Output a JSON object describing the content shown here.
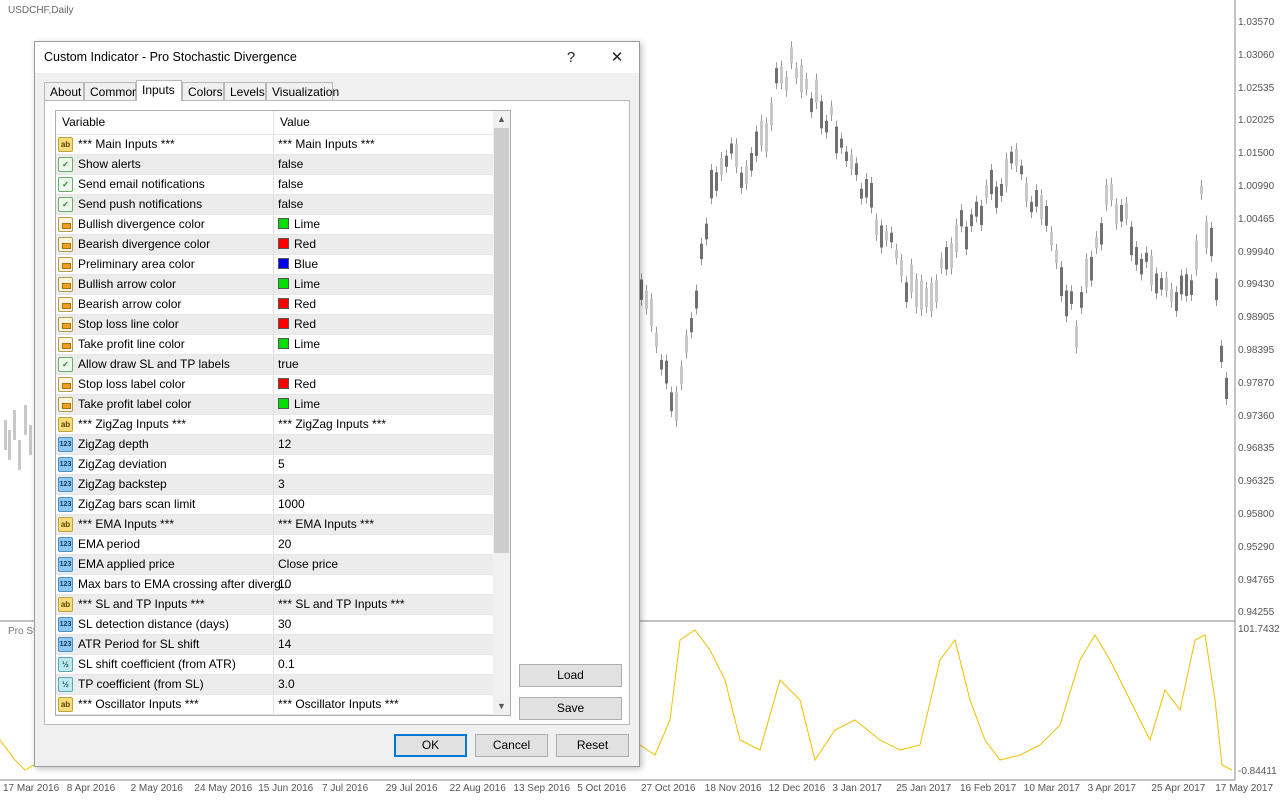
{
  "chart": {
    "symbol": "USDCHF,Daily",
    "price_axis": [
      "1.03570",
      "1.03060",
      "1.02535",
      "1.02025",
      "1.01500",
      "1.00990",
      "1.00465",
      "0.99940",
      "0.99430",
      "0.98905",
      "0.98395",
      "0.97870",
      "0.97360",
      "0.96835",
      "0.96325",
      "0.95800",
      "0.95290",
      "0.94765",
      "0.94255"
    ],
    "osc_axis_top": "101.74323",
    "osc_axis_bottom": "-0.84411",
    "osc_label": "Pro Sto",
    "date_axis": [
      "17 Mar 2016",
      "8 Apr 2016",
      "2 May 2016",
      "24 May 2016",
      "15 Jun 2016",
      "7 Jul 2016",
      "29 Jul 2016",
      "22 Aug 2016",
      "13 Sep 2016",
      "5 Oct 2016",
      "27 Oct 2016",
      "18 Nov 2016",
      "12 Dec 2016",
      "3 Jan 2017",
      "25 Jan 2017",
      "16 Feb 2017",
      "10 Mar 2017",
      "3 Apr 2017",
      "25 Apr 2017",
      "17 May 2017"
    ],
    "colors": {
      "bull": "#c8c8c8",
      "bear": "#707070",
      "osc": "#f0c000",
      "grid": "#cfcfcf"
    }
  },
  "dialog": {
    "title": "Custom Indicator - Pro Stochastic Divergence",
    "help": "?",
    "close": "✕",
    "tabs": [
      "About",
      "Common",
      "Inputs",
      "Colors",
      "Levels",
      "Visualization"
    ],
    "active_tab": "Inputs",
    "columns": {
      "variable": "Variable",
      "value": "Value"
    },
    "rows": [
      {
        "type": "ab",
        "name": "*** Main Inputs ***",
        "value": "*** Main Inputs ***"
      },
      {
        "type": "bool",
        "name": "Show alerts",
        "value": "false"
      },
      {
        "type": "bool",
        "name": "Send email notifications",
        "value": "false"
      },
      {
        "type": "bool",
        "name": "Send push notifications",
        "value": "false"
      },
      {
        "type": "color",
        "name": "Bullish divergence color",
        "value": "Lime",
        "swatch": "#00e000"
      },
      {
        "type": "color",
        "name": "Bearish divergence color",
        "value": "Red",
        "swatch": "#ff0000"
      },
      {
        "type": "color",
        "name": "Preliminary area color",
        "value": "Blue",
        "swatch": "#0000ee"
      },
      {
        "type": "color",
        "name": "Bullish arrow color",
        "value": "Lime",
        "swatch": "#00e000"
      },
      {
        "type": "color",
        "name": "Bearish arrow color",
        "value": "Red",
        "swatch": "#ff0000"
      },
      {
        "type": "color",
        "name": "Stop loss line color",
        "value": "Red",
        "swatch": "#ff0000"
      },
      {
        "type": "color",
        "name": "Take profit line color",
        "value": "Lime",
        "swatch": "#00e000"
      },
      {
        "type": "bool",
        "name": "Allow draw SL and TP labels",
        "value": "true"
      },
      {
        "type": "color",
        "name": "Stop loss label color",
        "value": "Red",
        "swatch": "#ff0000"
      },
      {
        "type": "color",
        "name": "Take profit label color",
        "value": "Lime",
        "swatch": "#00e000"
      },
      {
        "type": "ab",
        "name": "*** ZigZag Inputs ***",
        "value": "*** ZigZag Inputs ***"
      },
      {
        "type": "n123",
        "name": "ZigZag depth",
        "value": "12"
      },
      {
        "type": "n123",
        "name": "ZigZag deviation",
        "value": "5"
      },
      {
        "type": "n123",
        "name": "ZigZag backstep",
        "value": "3"
      },
      {
        "type": "n123",
        "name": "ZigZag bars scan limit",
        "value": "1000"
      },
      {
        "type": "ab",
        "name": "*** EMA Inputs ***",
        "value": "*** EMA Inputs ***"
      },
      {
        "type": "n123",
        "name": "EMA period",
        "value": "20"
      },
      {
        "type": "n123",
        "name": "EMA applied price",
        "value": "Close price"
      },
      {
        "type": "n123",
        "name": "Max bars to EMA crossing after diverg...",
        "value": "10"
      },
      {
        "type": "ab",
        "name": "*** SL and TP Inputs ***",
        "value": "*** SL and TP Inputs ***"
      },
      {
        "type": "n123",
        "name": "SL detection distance (days)",
        "value": "30"
      },
      {
        "type": "n123",
        "name": "ATR Period for SL shift",
        "value": "14"
      },
      {
        "type": "f12",
        "name": "SL shift coefficient (from ATR)",
        "value": "0.1"
      },
      {
        "type": "f12",
        "name": "TP coefficient (from SL)",
        "value": "3.0"
      },
      {
        "type": "ab",
        "name": "*** Oscillator Inputs ***",
        "value": "*** Oscillator Inputs ***"
      }
    ],
    "icons": {
      "ab": "ab",
      "n123": "123",
      "f12": "½",
      "bool": "✓",
      "color": ""
    },
    "buttons": {
      "load": "Load",
      "save": "Save",
      "ok": "OK",
      "cancel": "Cancel",
      "reset": "Reset"
    }
  }
}
